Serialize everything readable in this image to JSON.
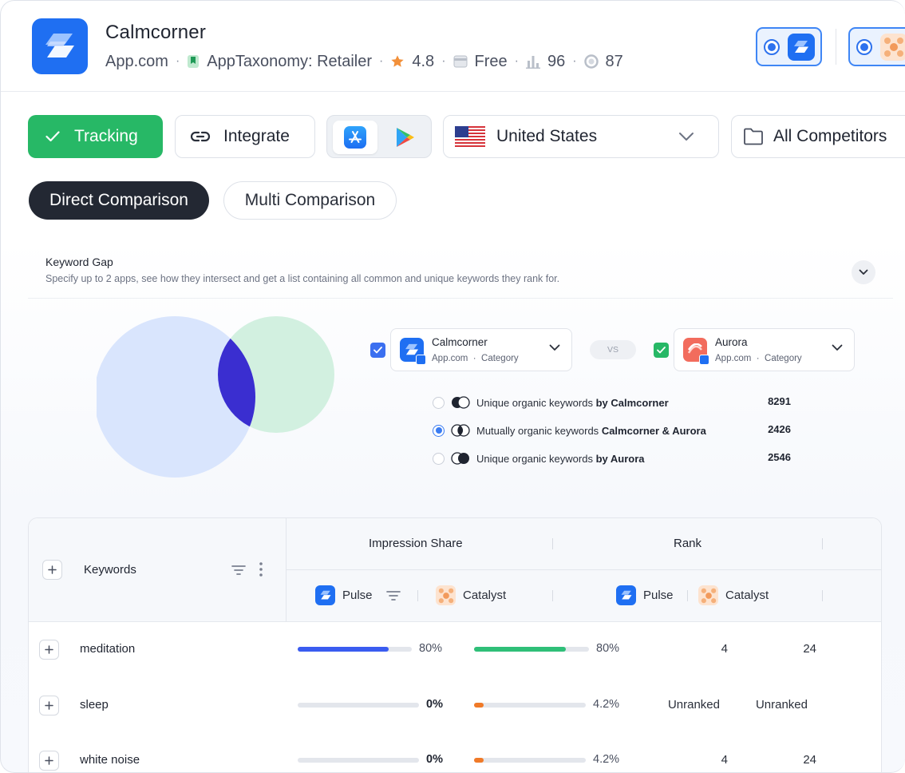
{
  "app": {
    "name": "Calmcorner",
    "developer": "App.com",
    "taxonomy": "AppTaxonomy: Retailer",
    "rating": "4.8",
    "price": "Free",
    "score_a": "96",
    "score_b": "87"
  },
  "toolbar": {
    "tracking_label": "Tracking",
    "integrate_label": "Integrate",
    "country": "United States",
    "competitors": "All Competitors"
  },
  "tabs": {
    "direct": "Direct Comparison",
    "multi": "Multi Comparison"
  },
  "keyword_gap": {
    "title": "Keyword Gap",
    "subtitle": "Specify up to 2 apps, see how they intersect and get a list containing all common and unique keywords they rank for.",
    "app_a": {
      "name": "Calmcorner",
      "developer": "App.com",
      "category": "Category"
    },
    "app_b": {
      "name": "Aurora",
      "developer": "App.com",
      "category": "Category"
    },
    "vs": "VS",
    "options": [
      {
        "prefix": "Unique organic keywords",
        "suffix": "by Calmcorner",
        "count": "8291"
      },
      {
        "prefix": "Mutually organic keywords",
        "suffix": "Calmcorner & Aurora",
        "count": "2426"
      },
      {
        "prefix": "Unique organic keywords",
        "suffix": "by Aurora",
        "count": "2546"
      }
    ],
    "selected_option": 1,
    "colors": {
      "circle_a": "#d9e5fd",
      "circle_b": "#d2f0e0",
      "overlap": "#3a2ed0"
    }
  },
  "table": {
    "col_keywords": "Keywords",
    "col_impression": "Impression Share",
    "col_rank": "Rank",
    "app_pulse": "Pulse",
    "app_catalyst": "Catalyst",
    "rows": [
      {
        "keyword": "meditation",
        "pulse_share": "80%",
        "pulse_fill": 0.8,
        "catalyst_share": "80%",
        "catalyst_fill": 0.8,
        "pulse_rank": "4",
        "catalyst_rank": "24"
      },
      {
        "keyword": "sleep",
        "pulse_share": "0%",
        "pulse_fill": 0,
        "catalyst_share": "4.2%",
        "catalyst_fill": 0.042,
        "pulse_rank": "Unranked",
        "catalyst_rank": "Unranked"
      },
      {
        "keyword": "white noise",
        "pulse_share": "0%",
        "pulse_fill": 0,
        "catalyst_share": "4.2%",
        "catalyst_fill": 0.042,
        "pulse_rank": "4",
        "catalyst_rank": "24"
      }
    ],
    "colors": {
      "pulse_bar": "#3a5cf0",
      "catalyst_bar": "#2fbf78",
      "low_bar": "#f07a28"
    }
  }
}
